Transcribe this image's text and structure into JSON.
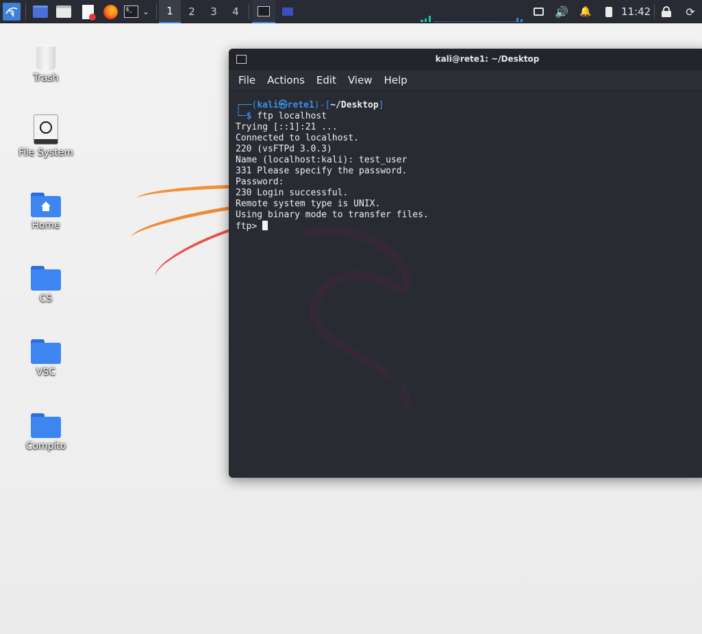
{
  "panel": {
    "workspaces": [
      "1",
      "2",
      "3",
      "4"
    ],
    "clock": "11:42"
  },
  "desktop_icons": [
    {
      "label": "Trash"
    },
    {
      "label": "File System"
    },
    {
      "label": "Home"
    },
    {
      "label": "CS"
    },
    {
      "label": "VSC"
    },
    {
      "label": "Compito"
    }
  ],
  "terminal": {
    "title": "kali@rete1: ~/Desktop",
    "menu": [
      "File",
      "Actions",
      "Edit",
      "View",
      "Help"
    ],
    "prompt": {
      "user": "kali",
      "host": "rete1",
      "dir": "~/Desktop",
      "command": "ftp localhost"
    },
    "output": [
      "Trying [::1]:21 ...",
      "Connected to localhost.",
      "220 (vsFTPd 3.0.3)",
      "Name (localhost:kali): test_user",
      "331 Please specify the password.",
      "Password:",
      "230 Login successful.",
      "Remote system type is UNIX.",
      "Using binary mode to transfer files."
    ],
    "ftp_prompt": "ftp>",
    "watermark": "KALI"
  }
}
